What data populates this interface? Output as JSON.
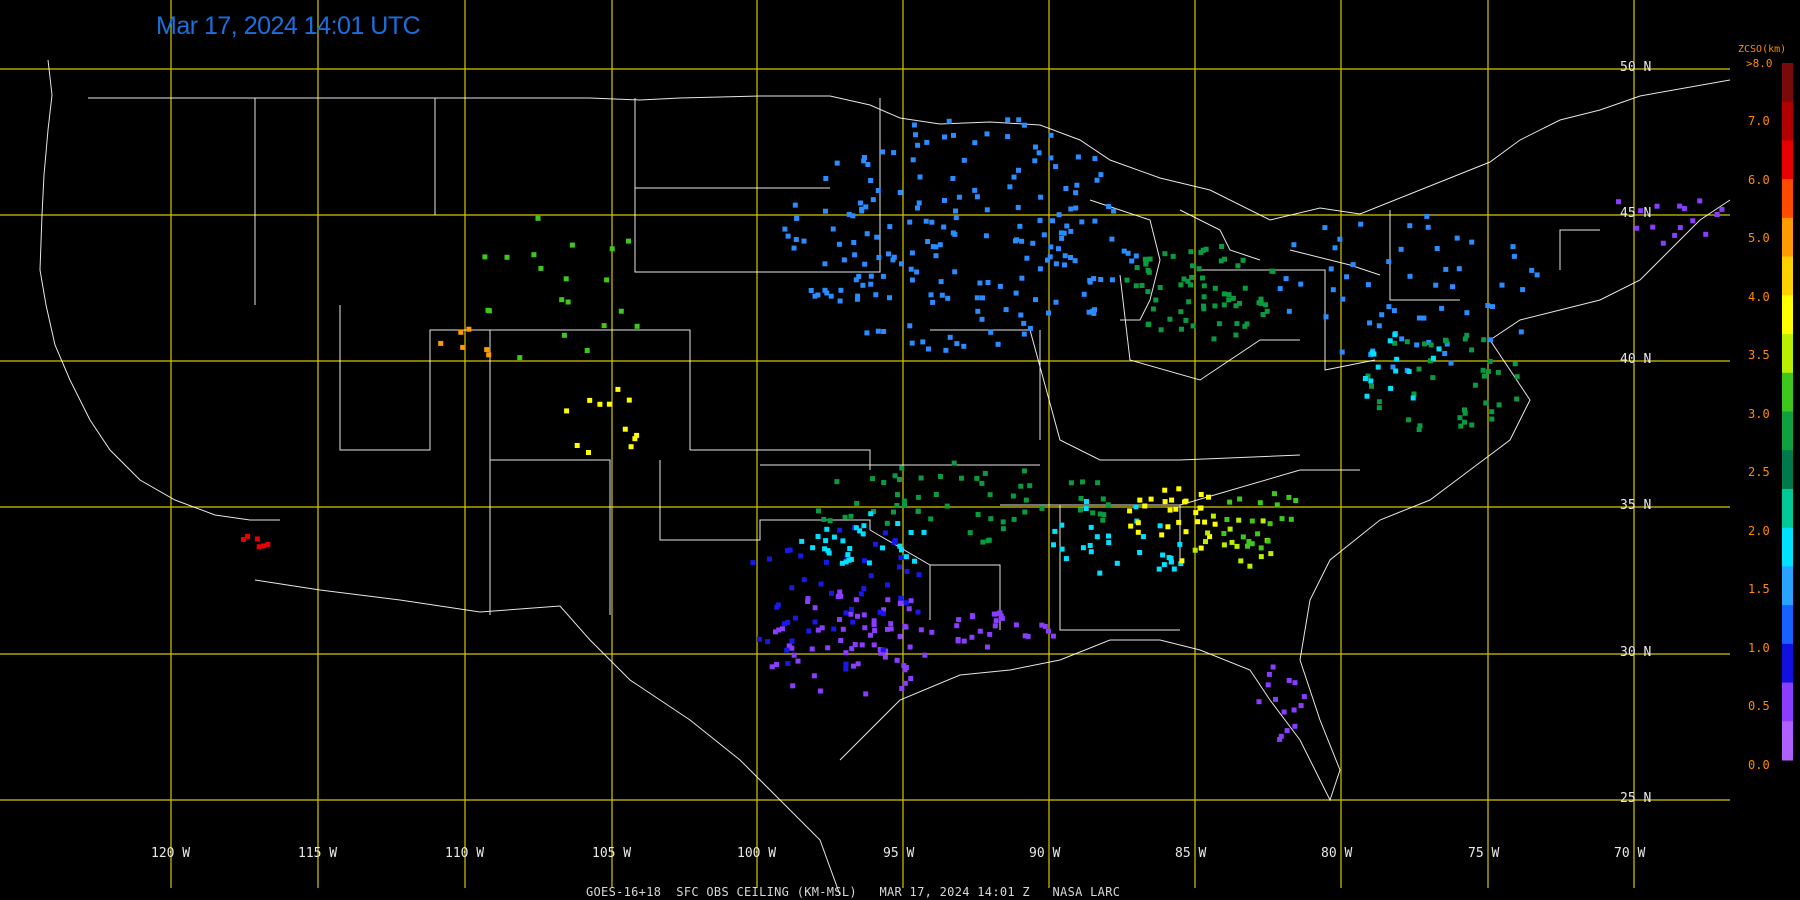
{
  "title": "Mar 17, 2024 14:01 UTC",
  "footer": "GOES-16+18  SFC OBS CEILING (KM-MSL)   MAR 17, 2024 14:01 Z   NASA LARC",
  "legend": {
    "title": "ZCSO(km)",
    "top_label": ">8.0",
    "ticks": [
      "7.0",
      "6.0",
      "5.0",
      "4.0",
      "3.5",
      "3.0",
      "2.5",
      "2.0",
      "1.5",
      "1.0",
      "0.5",
      "0.0"
    ],
    "colors": [
      "#7a0a0a",
      "#b00000",
      "#e60000",
      "#ff4a00",
      "#ff9a00",
      "#ffd000",
      "#ffff00",
      "#b8f000",
      "#3ec81e",
      "#10a040",
      "#007a4a",
      "#00c896",
      "#00e0ff",
      "#2aa2ff",
      "#1860ff",
      "#1010e0",
      "#8a3cff",
      "#b060ff"
    ]
  },
  "grid": {
    "lat_labels": [
      "50 N",
      "45 N",
      "40 N",
      "35 N",
      "30 N",
      "25 N"
    ],
    "lon_labels": [
      "120 W",
      "115 W",
      "110 W",
      "105 W",
      "100 W",
      "95 W",
      "90 W",
      "85 W",
      "80 W",
      "75 W",
      "70 W"
    ],
    "color": "#d4c600"
  },
  "observations": {
    "value_range_km": [
      0.0,
      8.0
    ],
    "bands": [
      {
        "color": "#8a3cff",
        "approx_count": 110
      },
      {
        "color": "#1818e8",
        "approx_count": 70
      },
      {
        "color": "#2a8cff",
        "approx_count": 260
      },
      {
        "color": "#00e0ff",
        "approx_count": 80
      },
      {
        "color": "#0a9a40",
        "approx_count": 120
      },
      {
        "color": "#3ec81e",
        "approx_count": 45
      },
      {
        "color": "#b8f000",
        "approx_count": 20
      },
      {
        "color": "#ffff00",
        "approx_count": 40
      },
      {
        "color": "#ff9a00",
        "approx_count": 10
      },
      {
        "color": "#e60000",
        "approx_count": 12
      }
    ]
  }
}
